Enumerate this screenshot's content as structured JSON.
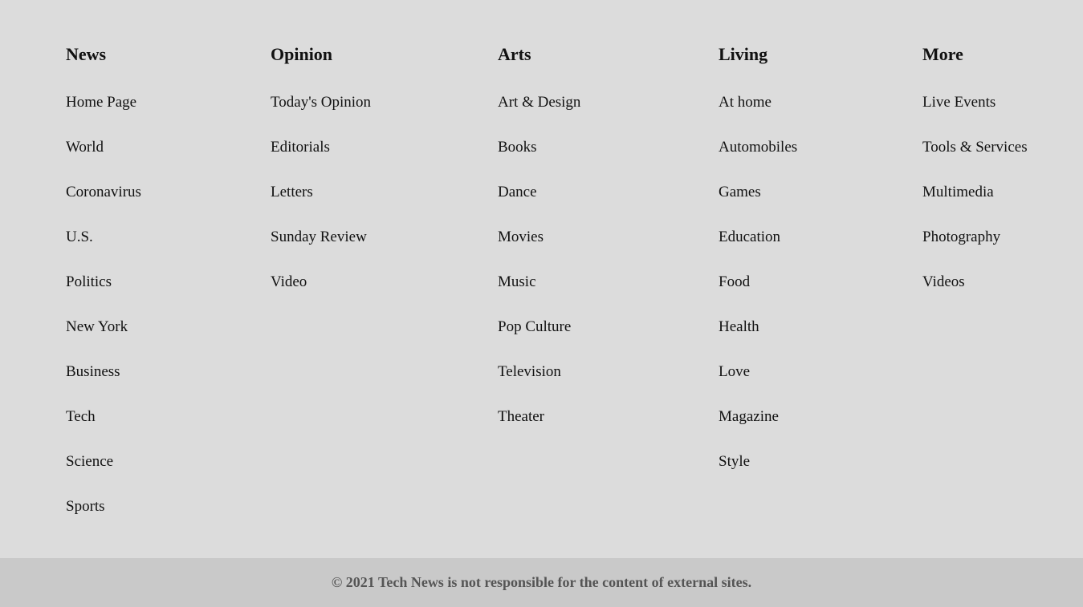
{
  "columns": [
    {
      "heading": "News",
      "links": [
        "Home Page",
        "World",
        "Coronavirus",
        "U.S.",
        "Politics",
        "New York",
        "Business",
        "Tech",
        "Science",
        "Sports"
      ]
    },
    {
      "heading": "Opinion",
      "links": [
        "Today's Opinion",
        "Editorials",
        "Letters",
        "Sunday Review",
        "Video"
      ]
    },
    {
      "heading": "Arts",
      "links": [
        "Art & Design",
        "Books",
        "Dance",
        "Movies",
        "Music",
        "Pop Culture",
        "Television",
        "Theater"
      ]
    },
    {
      "heading": "Living",
      "links": [
        "At home",
        "Automobiles",
        "Games",
        "Education",
        "Food",
        "Health",
        "Love",
        "Magazine",
        "Style"
      ]
    },
    {
      "heading": "More",
      "links": [
        "Live Events",
        "Tools & Services",
        "Multimedia",
        "Photography",
        "Videos"
      ]
    }
  ],
  "footer": {
    "copyright": "© 2021 Tech News is not responsible for the content of external sites."
  },
  "colors": {
    "background": "#dcdcdc",
    "footer_background": "#c9c9c9",
    "footer_text": "#555555",
    "text": "#111111"
  }
}
